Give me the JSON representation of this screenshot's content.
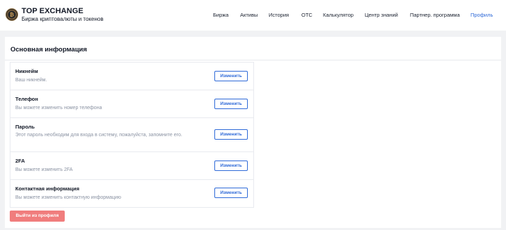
{
  "header": {
    "brand_title": "TOP EXCHANGE",
    "brand_subtitle": "Биржа криптовалюты и токенов",
    "logo_icon": "bitcoin-coin-icon",
    "nav": [
      {
        "label": "Биржа",
        "active": false
      },
      {
        "label": "Активы",
        "active": false
      },
      {
        "label": "История",
        "active": false
      },
      {
        "label": "OTC",
        "active": false
      },
      {
        "label": "Калькулятор",
        "active": false
      },
      {
        "label": "Центр знаний",
        "active": false
      },
      {
        "label": "Партнер. программа",
        "active": false
      },
      {
        "label": "Профиль",
        "active": true
      }
    ]
  },
  "profile": {
    "section_title": "Основная информация",
    "rows": [
      {
        "title": "Никнейм",
        "description": "Ваш никнейм.",
        "button": "Изменить"
      },
      {
        "title": "Телефон",
        "description": "Вы можете изменить номер телефона",
        "button": "Изменить"
      },
      {
        "title": "Пароль",
        "description": "Этот пароль необходим для входа в систему, пожалуйста, запомните его.",
        "button": "Изменить"
      },
      {
        "title": "2FA",
        "description": "Вы можете изменить 2FA",
        "button": "Изменить"
      },
      {
        "title": "Контактная информация",
        "description": "Вы можете изменить контактную информацию",
        "button": "Изменить"
      }
    ],
    "logout_label": "Выйти из профиля"
  },
  "colors": {
    "accent": "#2f6ad8",
    "danger": "#f07d7d",
    "page_bg": "#f1f2f4"
  }
}
